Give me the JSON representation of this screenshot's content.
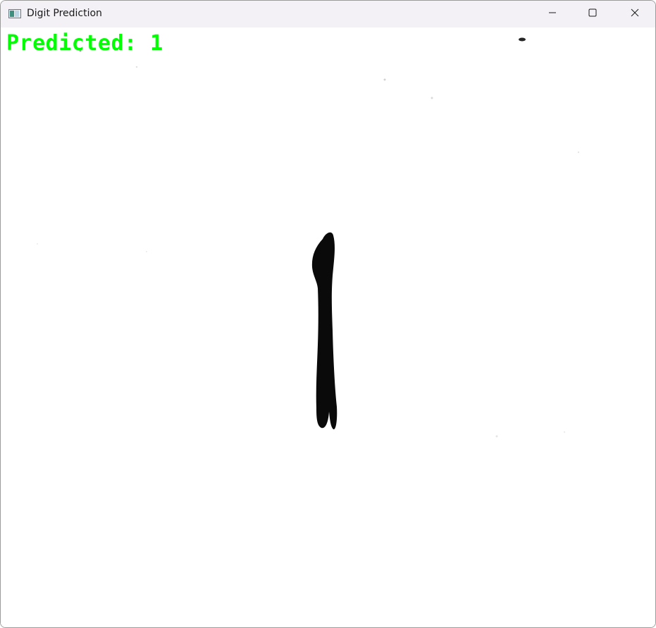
{
  "window": {
    "title": "Digit Prediction",
    "controls": {
      "minimize": "minimize-icon",
      "maximize": "maximize-icon",
      "close": "close-icon"
    }
  },
  "overlay": {
    "text": "Predicted: 1",
    "color": "#00ff00"
  },
  "image": {
    "background_color": "#ffffff",
    "stroke_color": "#0a0a0a"
  }
}
